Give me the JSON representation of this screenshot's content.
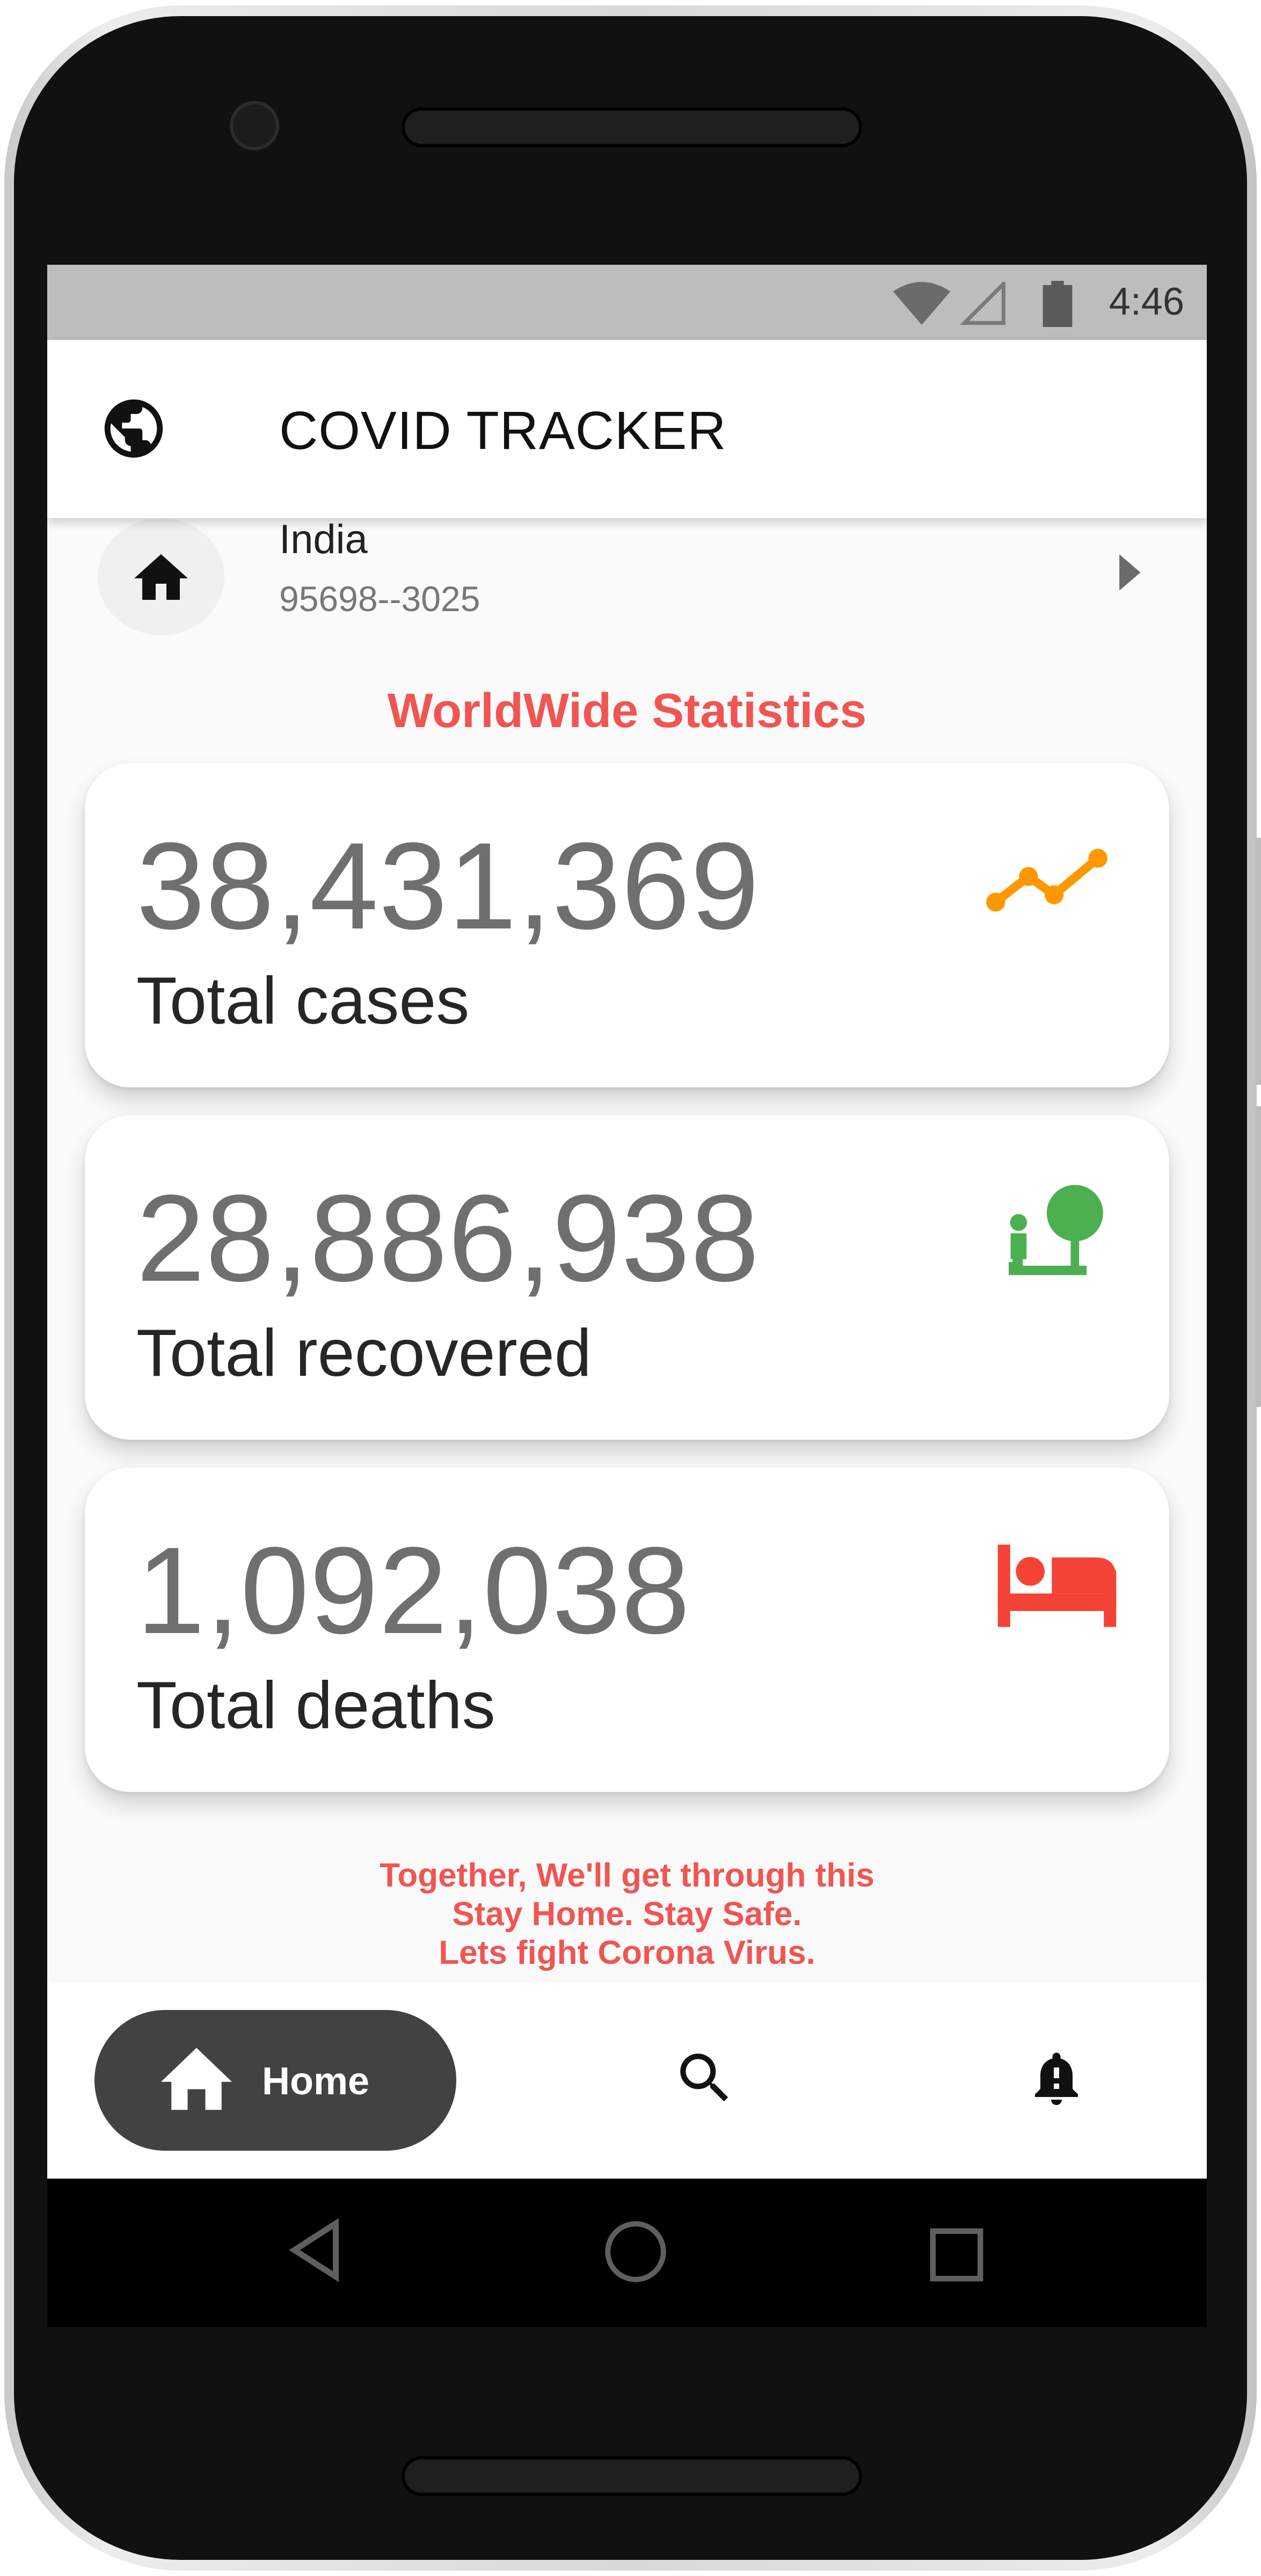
{
  "status_bar": {
    "time": "4:46"
  },
  "app_bar": {
    "title": "COVID TRACKER",
    "icon": "globe-icon"
  },
  "country": {
    "name": "India",
    "subtitle": "95698--3025",
    "icon": "home-icon"
  },
  "section_title": "WorldWide Statistics",
  "stats": [
    {
      "value": "38,431,369",
      "label": "Total cases",
      "icon": "trending-up-icon",
      "color": "#ff9800"
    },
    {
      "value": "28,886,938",
      "label": "Total recovered",
      "icon": "nature-people-icon",
      "color": "#4caf50"
    },
    {
      "value": "1,092,038",
      "label": "Total deaths",
      "icon": "hotel-bed-icon",
      "color": "#f44336"
    }
  ],
  "footer_message": [
    "Together, We'll get through this",
    "Stay Home. Stay Safe.",
    "Lets fight Corona Virus."
  ],
  "bottom_nav": {
    "home_label": "Home",
    "search_icon": "search-icon",
    "notifications_icon": "bell-icon"
  },
  "colors": {
    "accent_red": "#f05552",
    "nav_pill": "#424242",
    "status_bar": "#bdbdbd"
  }
}
